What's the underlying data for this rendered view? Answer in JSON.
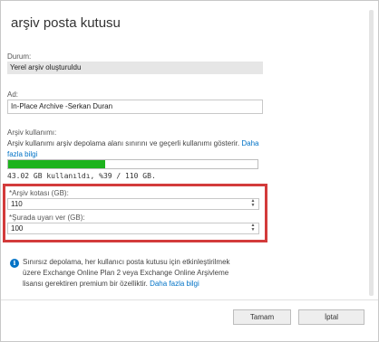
{
  "window": {
    "title": "arşiv posta kutusu"
  },
  "status": {
    "label": "Durum:",
    "value": "Yerel arşiv oluşturuldu"
  },
  "name": {
    "label": "Ad:",
    "value": "In-Place Archive -Serkan Duran"
  },
  "usage": {
    "label": "Arşiv kullanımı:",
    "description": "Arşiv kullanımı arşiv depolama alanı sınırını ve geçerli kullanımı gösterir.",
    "link_text": "Daha fazla bilgi",
    "progress_percent": 39,
    "summary": "43.02 GB kullanıldı, %39 / 110 GB."
  },
  "quota": {
    "label": "*Arşiv kotası (GB):",
    "value": "110"
  },
  "warning": {
    "label": "*Şurada uyarı ver (GB):",
    "value": "100"
  },
  "info": {
    "text": "Sınırsız depolama, her kullanıcı posta kutusu için etkinleştirilmek üzere Exchange Online Plan 2 veya Exchange Online Arşivleme lisansı gerektiren premium bir özelliktir.",
    "link_text": "Daha fazla bilgi"
  },
  "buttons": {
    "ok": "Tamam",
    "cancel": "İptal"
  },
  "colors": {
    "progress": "#1db31d",
    "highlight": "#d33b3b",
    "link": "#0072c6"
  }
}
